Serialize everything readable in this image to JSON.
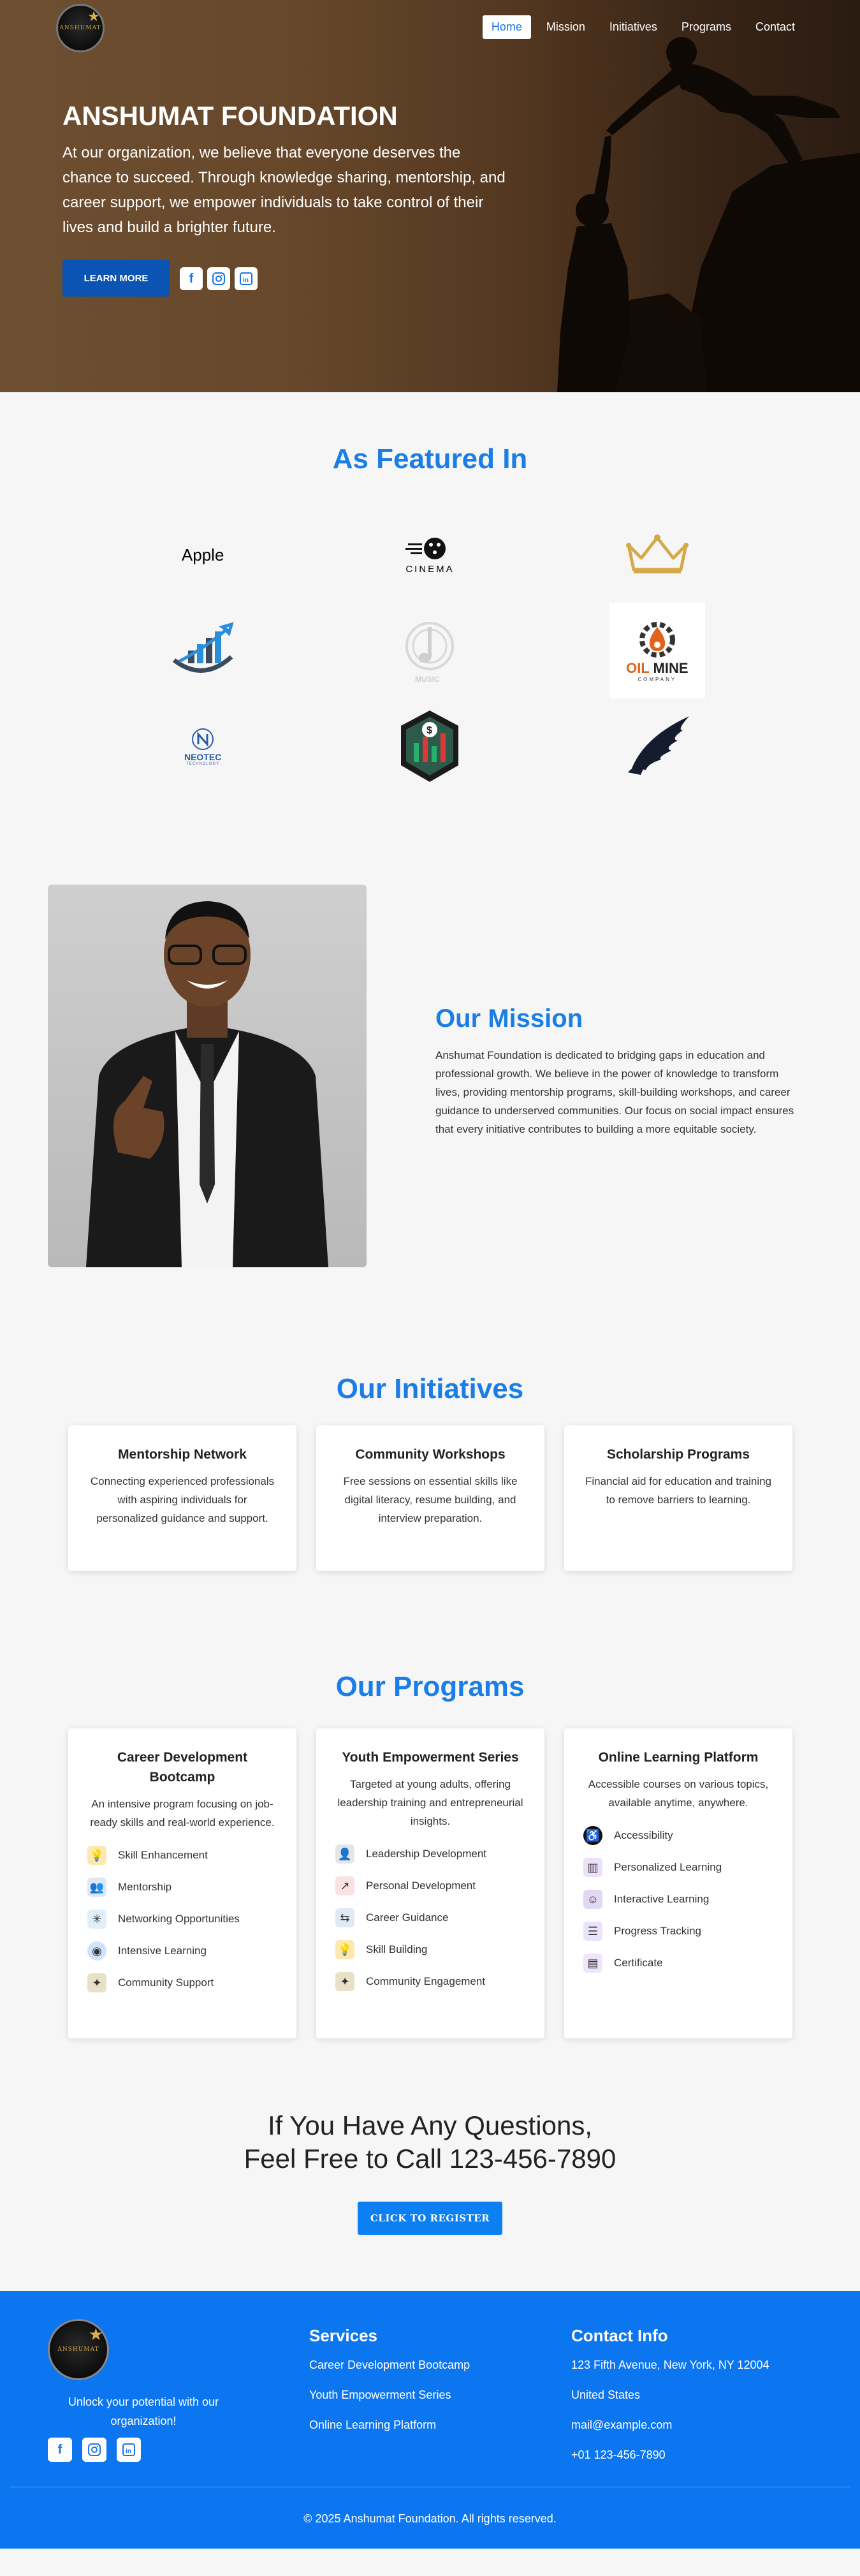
{
  "nav": {
    "logo_text": "ANSHUMAT",
    "links": [
      "Home",
      "Mission",
      "Initiatives",
      "Programs",
      "Contact"
    ],
    "active": "Home"
  },
  "hero": {
    "title": "ANSHUMAT FOUNDATION",
    "text": "At our organization, we believe that everyone deserves the chance to succeed. Through knowledge sharing, mentorship, and career support, we empower individuals to take control of their lives and build a brighter future.",
    "button": "LEARN MORE",
    "social": [
      "facebook-icon",
      "instagram-icon",
      "linkedin-icon"
    ]
  },
  "featured": {
    "title": "As Featured In",
    "logos": {
      "apple": "Apple",
      "cinema": "CINEMA",
      "music": "MUSIC",
      "oilmine_a": "OIL",
      "oilmine_b": "MINE",
      "oilmine_sub": "COMPANY",
      "neo": "NEOTEC",
      "neo_sub": "TECHNOLOGY"
    }
  },
  "mission": {
    "title": "Our Mission",
    "text": "Anshumat Foundation is dedicated to bridging gaps in education and professional growth. We believe in the power of knowledge to transform lives, providing mentorship programs, skill-building workshops, and career guidance to underserved communities. Our focus on social impact ensures that every initiative contributes to building a more equitable society."
  },
  "initiatives": {
    "title": "Our Initiatives",
    "cards": [
      {
        "title": "Mentorship Network",
        "desc": "Connecting experienced professionals with aspiring individuals for personalized guidance and support."
      },
      {
        "title": "Community Workshops",
        "desc": "Free sessions on essential skills like digital literacy, resume building, and interview preparation."
      },
      {
        "title": "Scholarship Programs",
        "desc": "Financial aid for education and training to remove barriers to learning."
      }
    ]
  },
  "programs": {
    "title": "Our Programs",
    "cards": [
      {
        "title": "Career Development Bootcamp",
        "desc": "An intensive program focusing on job-ready skills and real-world experience.",
        "features": [
          "Skill Enhancement",
          "Mentorship",
          "Networking Opportunities",
          "Intensive Learning",
          "Community Support"
        ]
      },
      {
        "title": "Youth Empowerment Series",
        "desc": "Targeted at young adults, offering leadership training and entrepreneurial insights.",
        "features": [
          "Leadership Development",
          "Personal Development",
          "Career Guidance",
          "Skill Building",
          "Community Engagement"
        ]
      },
      {
        "title": "Online Learning Platform",
        "desc": "Accessible courses on various topics, available anytime, anywhere.",
        "features": [
          "Accessibility",
          "Personalized Learning",
          "Interactive Learning",
          "Progress Tracking",
          "Certificate"
        ]
      }
    ]
  },
  "cta": {
    "line1": "If You Have Any Questions,",
    "line2": "Feel Free to Call 123-456-7890",
    "button": "CLICK TO REGISTER"
  },
  "footer": {
    "tagline": "Unlock your potential with our organization!",
    "services_title": "Services",
    "services": [
      "Career Development Bootcamp",
      "Youth Empowerment Series",
      "Online Learning Platform"
    ],
    "contact_title": "Contact Info",
    "address": "123 Fifth Avenue, New York, NY 12004",
    "country": "United States",
    "email": "mail@example.com",
    "phone": "+01 123-456-7890",
    "copyright": "© 2025 Anshumat Foundation. All rights reserved."
  },
  "colors": {
    "accent": "#1a7ee6",
    "hero_button": "#0b54b3",
    "footer_bg": "#0c75f0"
  }
}
